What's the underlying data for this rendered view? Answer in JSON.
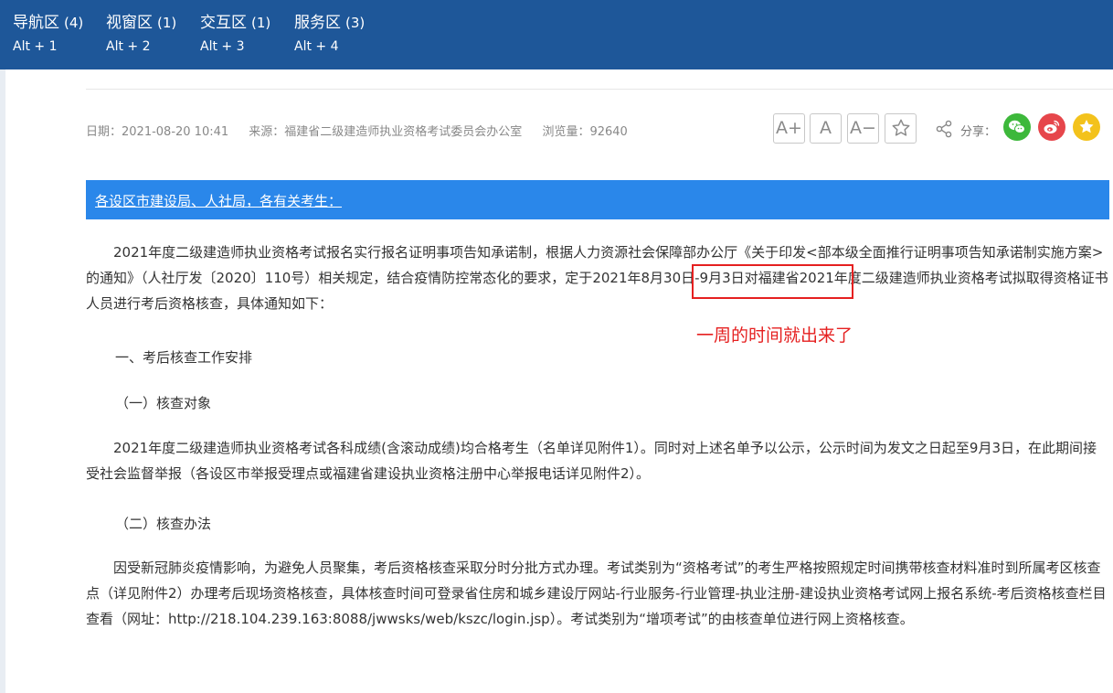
{
  "topbar": {
    "zones": [
      {
        "name": "导航区",
        "count": "(4)",
        "key": "Alt + 1"
      },
      {
        "name": "视窗区",
        "count": "(1)",
        "key": "Alt + 2"
      },
      {
        "name": "交互区",
        "count": "(1)",
        "key": "Alt + 3"
      },
      {
        "name": "服务区",
        "count": "(3)",
        "key": "Alt + 4"
      }
    ],
    "bg_color": "#1e5799"
  },
  "meta": {
    "date": "日期：2021-08-20 10:41",
    "source": "来源：福建省二级建造师执业资格考试委员会办公室",
    "views": "浏览量：92640"
  },
  "tools": {
    "font_plus": "A+",
    "font_normal": "A",
    "font_minus": "A−",
    "favorite_icon": "star-icon",
    "share_label": "分享："
  },
  "banner": {
    "text": "各设区市建设局、人社局，各有关考生：",
    "color": "#2a87ea"
  },
  "content": {
    "p1_a": "2021年度二级建造师执业资格考试报名实行报名证明事项告知承诺制，根据人力资源社会保障部办公厅《关于印发<部本级全面推行证明事项告知承诺制实施方案>的通知》（人社厅发〔2020〕110号）相关规定，结合疫情防控常态化的要求，定于",
    "p1_highlight": "2021年8月30日-9月3日",
    "p1_b": "对福建省2021年度二级建造师执业资格考试拟取得资格证书人员进行考后资格核查，具体通知如下：",
    "h1": "一、考后核查工作安排",
    "h2": "（一）核查对象",
    "p2": "2021年度二级建造师执业资格考试各科成绩(含滚动成绩)均合格考生（名单详见附件1）。同时对上述名单予以公示，公示时间为发文之日起至9月3日，在此期间接受社会监督举报（各设区市举报受理点或福建省建设执业资格注册中心举报电话详见附件2）。",
    "h3": "（二）核查办法",
    "p3": "因受新冠肺炎疫情影响，为避免人员聚集，考后资格核查采取分时分批方式办理。考试类别为“资格考试”的考生严格按照规定时间携带核查材料准时到所属考区核查点（详见附件2）办理考后现场资格核查，具体核查时间可登录省住房和城乡建设厅网站-行业服务-行业管理-执业注册-建设执业资格考试网上报名系统-考后资格核查栏目查看（网址：http://218.104.239.163:8088/jwwsks/web/kszc/login.jsp）。考试类别为“增项考试”的由核查单位进行网上资格核查。"
  },
  "annotation": {
    "text": "一周的时间就出来了",
    "color": "#e52020"
  }
}
